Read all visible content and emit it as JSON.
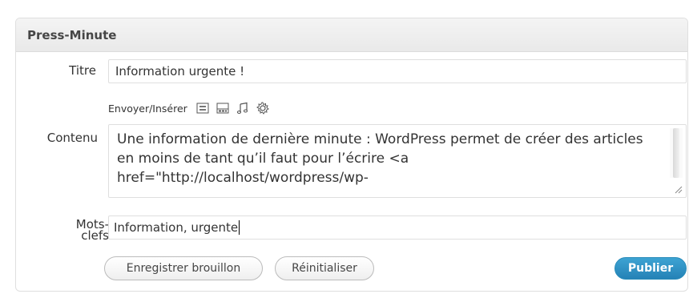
{
  "widget": {
    "title": "Press-Minute"
  },
  "form": {
    "title_label": "Titre",
    "title_value": "Information urgente !",
    "media_label": "Envoyer/Insérer",
    "media_icons": [
      "image-icon",
      "video-icon",
      "audio-icon",
      "media-icon"
    ],
    "content_label": "Contenu",
    "content_value": "Une information de dernière minute : WordPress permet de créer des articles en moins de tant qu’il faut pour l’écrire <a href=\"http://localhost/wordpress/wp-",
    "tags_label": "Mots-\nclefs",
    "tags_value": "Information, urgente"
  },
  "actions": {
    "save_draft": "Enregistrer brouillon",
    "reset": "Réinitialiser",
    "publish": "Publier"
  },
  "colors": {
    "publish_bg": "#2582b6",
    "border": "#dfdfdf",
    "header_bg": "#f1f1f1"
  }
}
